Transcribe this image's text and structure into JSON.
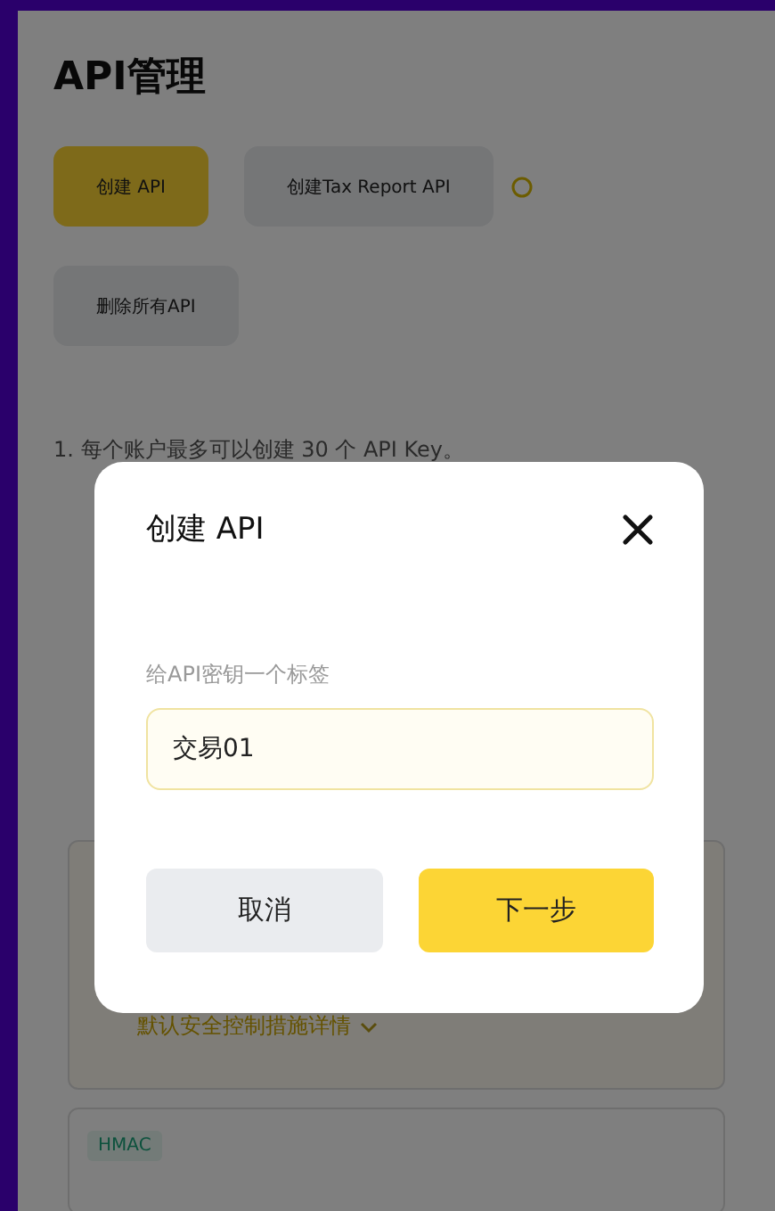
{
  "page": {
    "title": "API管理",
    "actions": [
      {
        "label": "创建 API",
        "kind": "primary"
      },
      {
        "label": "创建Tax Report API",
        "kind": "secondary",
        "info": true
      },
      {
        "label": "删除所有API",
        "kind": "secondary",
        "info": false
      }
    ],
    "notes": [
      "1. 每个账户最多可以创建 30 个 API Key。"
    ],
    "security_link": "默认安全控制措施详情",
    "key_type_tag": "HMAC"
  },
  "dialog": {
    "title": "创建 API",
    "field": {
      "label": "给API密钥一个标签",
      "value": "交易01"
    },
    "buttons": [
      {
        "label": "取消",
        "kind": "cancel"
      },
      {
        "label": "下一步",
        "kind": "primary"
      }
    ]
  }
}
